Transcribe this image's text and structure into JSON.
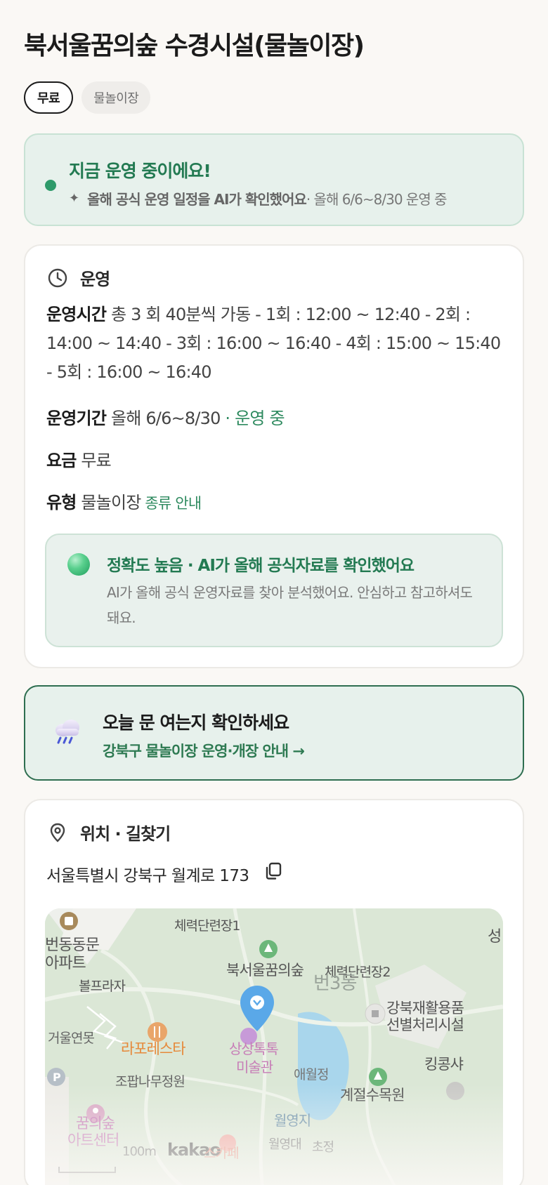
{
  "header": {
    "title": "북서울꿈의숲 수경시설(물놀이장)",
    "chips": [
      "무료",
      "물놀이장"
    ]
  },
  "status": {
    "title": "지금 운영 중이에요!",
    "sub_bold": "올해 공식 운영 일정을 AI가 확인했어요",
    "sub_rest": " · 올해 6/6~8/30 운영 중"
  },
  "operation": {
    "section_title": "운영",
    "hours_label": "운영시간",
    "hours_value": " 총 3 회 40분씩 가동 - 1회 : 12:00 ~ 12:40 - 2회 : 14:00 ~ 14:40 - 3회 : 16:00 ~ 16:40 - 4회 : 15:00 ~ 15:40 - 5회 : 16:00 ~ 16:40",
    "period_label": "운영기간",
    "period_value": " 올해 6/6~8/30",
    "period_status": " · 운영 중",
    "fee_label": "요금",
    "fee_value": " 무료",
    "type_label": "유형",
    "type_value": " 물놀이장",
    "type_link": " 종류 안내",
    "accuracy_title": "정확도 높음 · AI가 올해 공식자료를 확인했어요",
    "accuracy_desc": "AI가 올해 공식 운영자료를 찾아 분석했어요. 안심하고 참고하셔도 돼요."
  },
  "notice": {
    "title": "오늘 문 여는지 확인하세요",
    "link": "강북구 물놀이장 운영·개장 안내 →"
  },
  "location": {
    "section_title": "위치 · 길찾기",
    "address": "서울특별시 강북구 월계로 173",
    "map_labels": {
      "l1": "체력단련장1",
      "l2a": "번동동문",
      "l2b": "아파트",
      "l3": "북서울꿈의숲",
      "l4": "체력단련장2",
      "l5": "번3동",
      "l6": "볼프라자",
      "l7a": "강북재활용품",
      "l7b": "선별처리시설",
      "l8": "거울연못",
      "l9": "라포레스타",
      "l10a": "상상톡톡",
      "l10b": "미술관",
      "l11": "애월정",
      "l12": "킹콩샤",
      "l13": "조팝나무정원",
      "l14": "계절수목원",
      "l15a": "꿈의숲",
      "l15b": "아트센터",
      "l16": "월영지",
      "l17": "100m",
      "l18": "kakao",
      "l19": "스카페",
      "l20": "월영대",
      "l21": "초정",
      "l22": "성"
    }
  },
  "colors": {
    "accent_green": "#2e8a5f",
    "status_bg": "#e7f1ec",
    "page_bg": "#faf8f5"
  }
}
